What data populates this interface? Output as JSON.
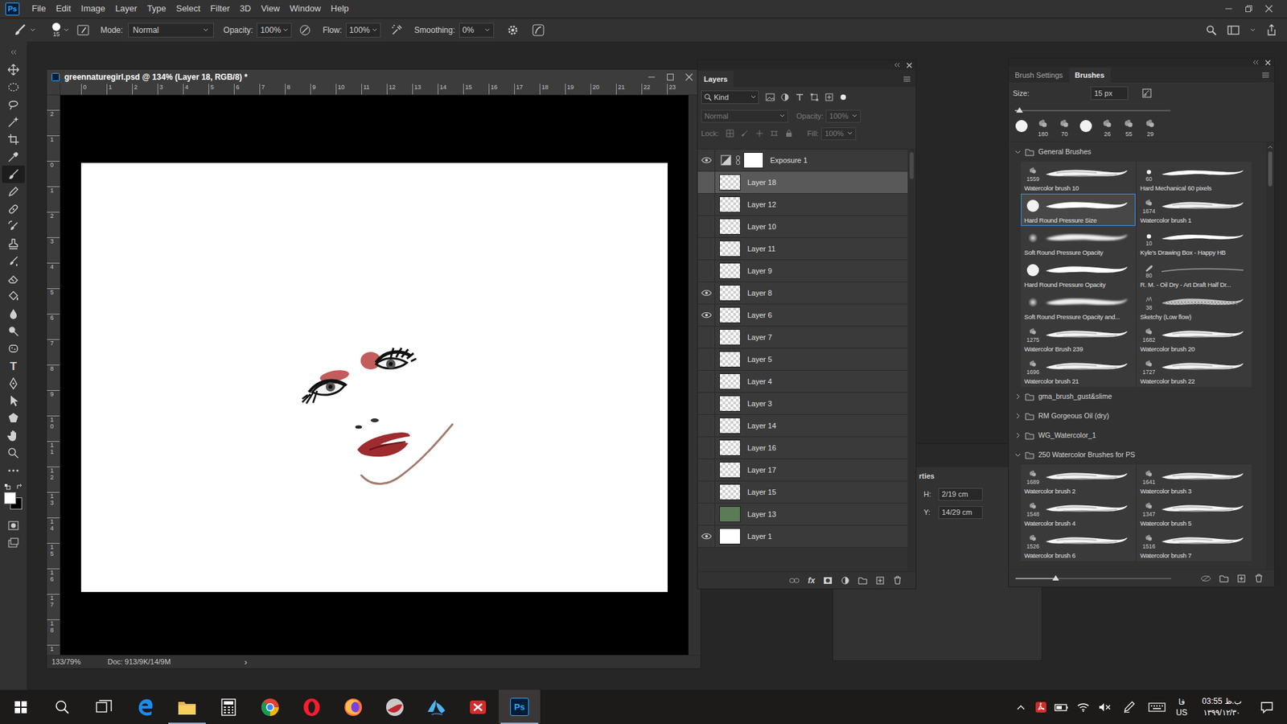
{
  "app": {
    "logo": "Ps"
  },
  "menu": [
    "File",
    "Edit",
    "Image",
    "Layer",
    "Type",
    "Select",
    "Filter",
    "3D",
    "View",
    "Window",
    "Help"
  ],
  "options": {
    "brush_size": "15",
    "mode_label": "Mode:",
    "mode": "Normal",
    "opacity_label": "Opacity:",
    "opacity": "100%",
    "flow_label": "Flow:",
    "flow": "100%",
    "smoothing_label": "Smoothing:",
    "smoothing": "0%"
  },
  "tools": [
    {
      "kind": "move",
      "selected": false
    },
    {
      "kind": "marquee",
      "selected": false
    },
    {
      "kind": "lasso",
      "selected": false
    },
    {
      "kind": "wand",
      "selected": false
    },
    {
      "kind": "crop",
      "selected": false
    },
    {
      "kind": "eyedropper",
      "selected": false
    },
    {
      "kind": "brush",
      "selected": true
    },
    {
      "kind": "pencil",
      "selected": false
    },
    {
      "kind": "heal",
      "selected": false
    },
    {
      "kind": "history",
      "selected": false
    },
    {
      "kind": "stamp",
      "selected": false
    },
    {
      "kind": "mixer",
      "selected": false
    },
    {
      "kind": "eraser",
      "selected": false
    },
    {
      "kind": "bucket",
      "selected": false
    },
    {
      "kind": "blur",
      "selected": false
    },
    {
      "kind": "dodge",
      "selected": false
    },
    {
      "kind": "sponge",
      "selected": false
    },
    {
      "kind": "type",
      "label": "T",
      "selected": false
    },
    {
      "kind": "pen",
      "selected": false
    },
    {
      "kind": "path",
      "selected": false
    },
    {
      "kind": "shape",
      "selected": false
    },
    {
      "kind": "hand",
      "selected": false
    },
    {
      "kind": "zoom",
      "selected": false
    },
    {
      "kind": "more",
      "selected": false
    }
  ],
  "swatches": {
    "foreground": "#ffffff",
    "background": "#000000"
  },
  "document": {
    "title": "greennaturegirl.psd @ 134% (Layer 18, RGB/8) *",
    "ruler_h": [
      "0",
      "1",
      "2",
      "3",
      "4",
      "5",
      "6",
      "7",
      "8",
      "9",
      "10",
      "11",
      "12",
      "13",
      "14",
      "15",
      "16",
      "17",
      "18",
      "19",
      "20",
      "21",
      "22",
      "23"
    ],
    "ruler_v": [
      "2",
      "1",
      "0",
      "1",
      "2",
      "3",
      "4",
      "5",
      "6",
      "7",
      "8",
      "9",
      "10",
      "11",
      "12",
      "13",
      "14",
      "15",
      "16",
      "17",
      "18",
      "1"
    ],
    "zoom": "133/79%",
    "doc_info": "Doc: 913/9K/14/9M",
    "arrow": "›"
  },
  "layers": {
    "tab": "Layers",
    "filter": "Kind",
    "blend": "Normal",
    "opacity_label": "Opacity:",
    "opacity": "100%",
    "lock_label": "Lock:",
    "fill_label": "Fill:",
    "fill": "100%",
    "controls_disabled": true,
    "fx": "fx",
    "items": [
      {
        "name": "Exposure 1",
        "visible": true,
        "selected": false,
        "kind": "adjustment"
      },
      {
        "name": "Layer 18",
        "visible": false,
        "selected": true,
        "kind": "pixel"
      },
      {
        "name": "Layer 12",
        "visible": false,
        "selected": false,
        "kind": "pixel"
      },
      {
        "name": "Layer 10",
        "visible": false,
        "selected": false,
        "kind": "pixel"
      },
      {
        "name": "Layer 11",
        "visible": false,
        "selected": false,
        "kind": "pixel"
      },
      {
        "name": "Layer 9",
        "visible": false,
        "selected": false,
        "kind": "pixel"
      },
      {
        "name": "Layer 8",
        "visible": true,
        "selected": false,
        "kind": "pixel"
      },
      {
        "name": "Layer 6",
        "visible": true,
        "selected": false,
        "kind": "pixel"
      },
      {
        "name": "Layer 7",
        "visible": false,
        "selected": false,
        "kind": "pixel"
      },
      {
        "name": "Layer 5",
        "visible": false,
        "selected": false,
        "kind": "pixel"
      },
      {
        "name": "Layer 4",
        "visible": false,
        "selected": false,
        "kind": "pixel"
      },
      {
        "name": "Layer 3",
        "visible": false,
        "selected": false,
        "kind": "pixel"
      },
      {
        "name": "Layer 14",
        "visible": false,
        "selected": false,
        "kind": "pixel"
      },
      {
        "name": "Layer 16",
        "visible": false,
        "selected": false,
        "kind": "pixel"
      },
      {
        "name": "Layer 17",
        "visible": false,
        "selected": false,
        "kind": "pixel"
      },
      {
        "name": "Layer 15",
        "visible": false,
        "selected": false,
        "kind": "pixel"
      },
      {
        "name": "Layer 13",
        "visible": false,
        "selected": false,
        "kind": "solid",
        "color": "#5b7a56"
      },
      {
        "name": "Layer 1",
        "visible": true,
        "selected": false,
        "kind": "solid",
        "color": "#ffffff"
      }
    ]
  },
  "properties": {
    "title": "rties",
    "fields": [
      {
        "label": "H:",
        "value": "2/19 cm"
      },
      {
        "label": "Y:",
        "value": "14/29 cm"
      }
    ]
  },
  "brushes": {
    "tabs": [
      {
        "label": "Brush Settings",
        "selected": false
      },
      {
        "label": "Brushes",
        "selected": true
      }
    ],
    "size_label": "Size:",
    "size": "15 px",
    "size_level": 0.03,
    "preview_level": 0.26,
    "recent": [
      {
        "kind": "hard"
      },
      {
        "kind": "texture",
        "size": "180"
      },
      {
        "kind": "texture",
        "size": "70"
      },
      {
        "kind": "hard"
      },
      {
        "kind": "texture",
        "size": "26"
      },
      {
        "kind": "texture",
        "size": "55"
      },
      {
        "kind": "texture",
        "size": "29"
      }
    ],
    "groups": [
      {
        "name": "General Brushes",
        "expanded": true,
        "brushes": [
          {
            "name": "Watercolor brush 10",
            "count": "1559",
            "kind": "texture",
            "selected": false
          },
          {
            "name": "Hard Mechanical 60 pixels",
            "count": "60",
            "kind": "dot",
            "selected": false
          },
          {
            "name": "Hard Round Pressure Size",
            "kind": "hard",
            "selected": true
          },
          {
            "name": "Watercolor brush 1",
            "count": "1674",
            "kind": "texture",
            "selected": false
          },
          {
            "name": "Soft Round Pressure Opacity",
            "kind": "soft",
            "selected": false
          },
          {
            "name": "Kyle's Drawing Box - Happy HB",
            "count": "10",
            "kind": "dot",
            "selected": false
          },
          {
            "name": "Hard Round Pressure Opacity",
            "kind": "hard",
            "selected": false
          },
          {
            "name": "R. M. - Oil Dry - Art Draft Half Dr...",
            "count": "80",
            "kind": "line",
            "selected": false
          },
          {
            "name": "Soft Round Pressure Opacity and...",
            "kind": "soft",
            "selected": false
          },
          {
            "name": "Sketchy (Low flow)",
            "count": "38",
            "kind": "sketchy",
            "selected": false
          },
          {
            "name": "Watercolor Brush 239",
            "count": "1275",
            "kind": "texture",
            "selected": false
          },
          {
            "name": "Watercolor brush 20",
            "count": "1682",
            "kind": "texture",
            "selected": false
          },
          {
            "name": "Watercolor brush 21",
            "count": "1696",
            "kind": "texture",
            "selected": false
          },
          {
            "name": "Watercolor brush 22",
            "count": "1727",
            "kind": "texture",
            "selected": false
          }
        ]
      },
      {
        "name": "gma_brush_gust&slime",
        "expanded": false,
        "brushes": []
      },
      {
        "name": "RM Gorgeous Oil (dry)",
        "expanded": false,
        "brushes": []
      },
      {
        "name": "WG_Watercolor_1",
        "expanded": false,
        "brushes": []
      },
      {
        "name": "250 Watercolor Brushes for PS",
        "expanded": true,
        "brushes": [
          {
            "name": "Watercolor brush 2",
            "count": "1689",
            "kind": "texture",
            "selected": false
          },
          {
            "name": "Watercolor brush 3",
            "count": "1641",
            "kind": "texture",
            "selected": false
          },
          {
            "name": "Watercolor brush 4",
            "count": "1548",
            "kind": "texture",
            "selected": false
          },
          {
            "name": "Watercolor brush 5",
            "count": "1347",
            "kind": "texture",
            "selected": false
          },
          {
            "name": "Watercolor brush 6",
            "count": "1526",
            "kind": "texture",
            "selected": false
          },
          {
            "name": "Watercolor brush 7",
            "count": "1516",
            "kind": "texture",
            "selected": false
          }
        ]
      }
    ]
  },
  "taskbar": {
    "apps": [
      {
        "kind": "start",
        "running": false
      },
      {
        "kind": "search",
        "running": false
      },
      {
        "kind": "taskview",
        "running": false
      },
      {
        "kind": "edge",
        "running": false
      },
      {
        "kind": "explorer",
        "running": true
      },
      {
        "kind": "calculator",
        "running": false
      },
      {
        "kind": "chrome",
        "running": false
      },
      {
        "kind": "opera",
        "running": false
      },
      {
        "kind": "firefox",
        "running": false
      },
      {
        "kind": "sphere",
        "running": false
      },
      {
        "kind": "hands",
        "running": false
      },
      {
        "kind": "redapp",
        "running": false
      },
      {
        "kind": "photoshop",
        "label": "Ps",
        "running": true,
        "active": true
      }
    ],
    "tray": {
      "lang_top": "فا",
      "lang_bottom": "US",
      "time": "03:55 ب.ظ",
      "date": "۱۳۹۹/۱۲/۳۰"
    }
  }
}
